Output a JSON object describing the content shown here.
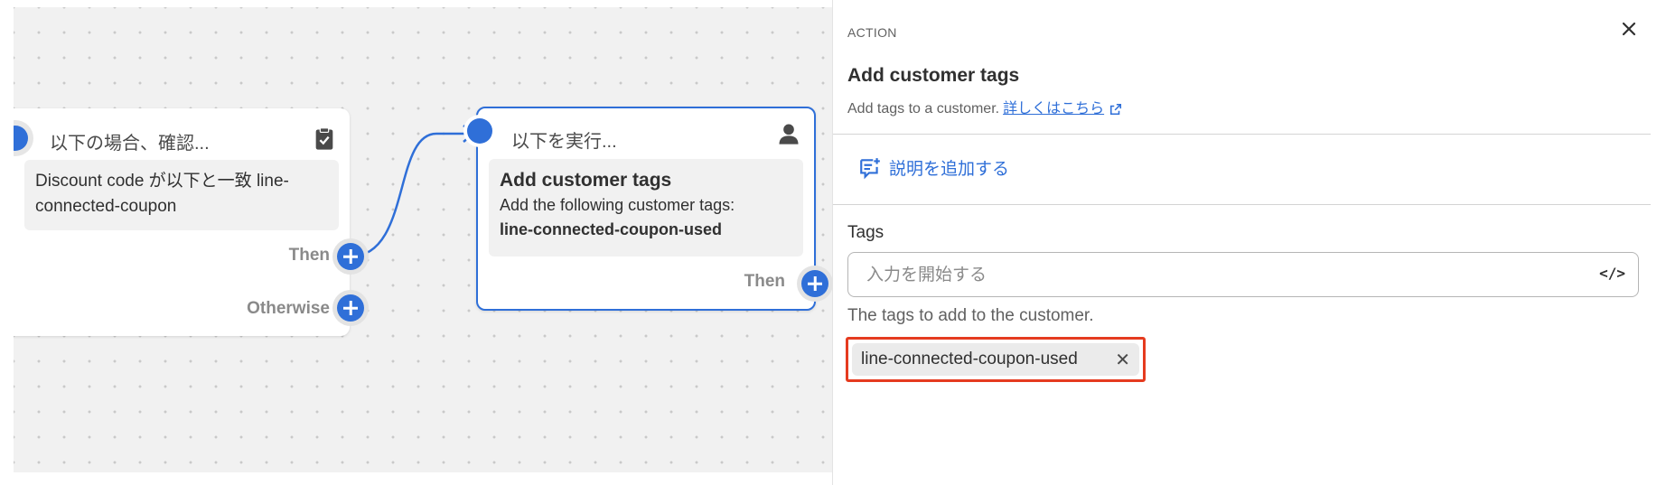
{
  "canvas": {
    "condition_node": {
      "header": "以下の場合、確認...",
      "body": "Discount code が以下と一致 line-connected-coupon",
      "branches": {
        "then": "Then",
        "otherwise": "Otherwise"
      }
    },
    "action_node": {
      "header": "以下を実行...",
      "title": "Add customer tags",
      "description": "Add the following customer tags:",
      "tag": "line-connected-coupon-used",
      "branch_then": "Then"
    }
  },
  "panel": {
    "eyebrow": "ACTION",
    "title": "Add customer tags",
    "subtitle": "Add tags to a customer.",
    "learn_more": "詳しくはこちら",
    "add_description": "説明を追加する",
    "tags_field": {
      "label": "Tags",
      "placeholder": "入力を開始する",
      "help": "The tags to add to the customer.",
      "values": [
        "line-connected-coupon-used"
      ]
    }
  },
  "colors": {
    "accent": "#2f6fd8",
    "highlight_border": "#e53b1f"
  }
}
